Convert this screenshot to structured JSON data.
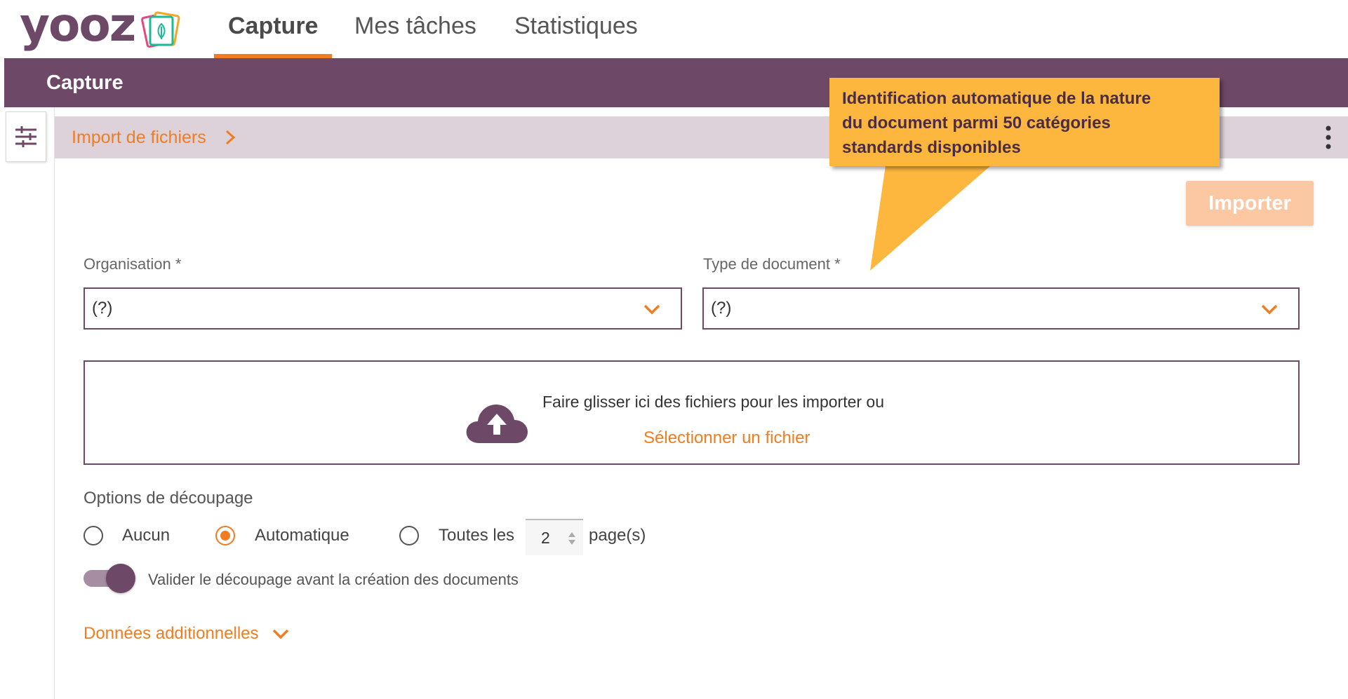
{
  "app": {
    "logo_text": "yooz"
  },
  "nav": {
    "tabs": [
      {
        "label": "Capture",
        "active": true
      },
      {
        "label": "Mes tâches",
        "active": false
      },
      {
        "label": "Statistiques",
        "active": false
      }
    ]
  },
  "header": {
    "title": "Capture"
  },
  "breadcrumb": {
    "label": "Import de fichiers"
  },
  "toolbar": {
    "importer_label": "Importer"
  },
  "form": {
    "organisation": {
      "label": "Organisation *",
      "value": "(?)"
    },
    "document_type": {
      "label": "Type de document *",
      "value": "(?)"
    }
  },
  "dropzone": {
    "text": "Faire glisser ici des fichiers pour les importer ou",
    "select_link": "Sélectionner un fichier"
  },
  "split_options": {
    "title": "Options de découpage",
    "options": [
      {
        "label": "Aucun",
        "checked": false
      },
      {
        "label": "Automatique",
        "checked": true
      },
      {
        "label": "Toutes les",
        "checked": false
      }
    ],
    "pages_value": "2",
    "pages_suffix": "page(s)"
  },
  "validate_toggle": {
    "label": "Valider le découpage avant la création des documents",
    "on": true
  },
  "additional_data": {
    "label": "Données additionnelles"
  },
  "callout": {
    "text": "Identification automatique de la nature\ndu document parmi 50 catégories\nstandards disponibles"
  },
  "colors": {
    "brand_purple": "#6e4867",
    "accent_orange": "#f07d22",
    "callout_yellow": "#fdb73f",
    "breadcrumb_bg": "#ddd1da",
    "importer_disabled": "#fcc8a3"
  },
  "icons": {
    "filter": "sliders-icon",
    "more": "more-vertical-icon",
    "chevron_right": "chevron-right-icon",
    "chevron_down": "chevron-down-icon",
    "upload": "cloud-upload-icon"
  }
}
